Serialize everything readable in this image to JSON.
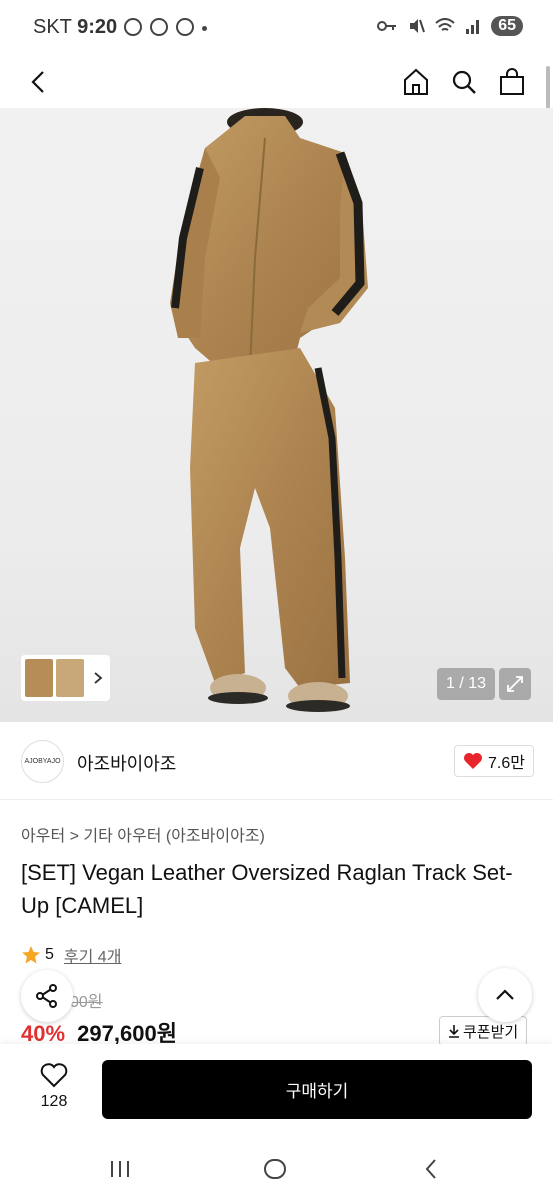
{
  "status_bar": {
    "carrier": "SKT",
    "time": "9:20",
    "battery": "65"
  },
  "gallery": {
    "counter": "1 / 13"
  },
  "brand": {
    "logo_text": "AJOBYAJO",
    "name": "아조바이아조",
    "likes": "7.6만"
  },
  "product": {
    "breadcrumb": "아우터 > 기타 아우터 (아조바이아조)",
    "title": "[SET] Vegan Leather Oversized Raglan Track Set-Up [CAMEL]",
    "rating": "5",
    "review_link": "후기 4개",
    "original_price_partial": "00원",
    "discount": "40%",
    "price": "297,600원",
    "coupon_label": "쿠폰받기"
  },
  "bottom_bar": {
    "wish_count": "128",
    "buy_label": "구매하기"
  },
  "colors": {
    "accent_red": "#e03232",
    "heart": "#e8242c",
    "star": "#f5a623",
    "camel": "#b68d56"
  }
}
